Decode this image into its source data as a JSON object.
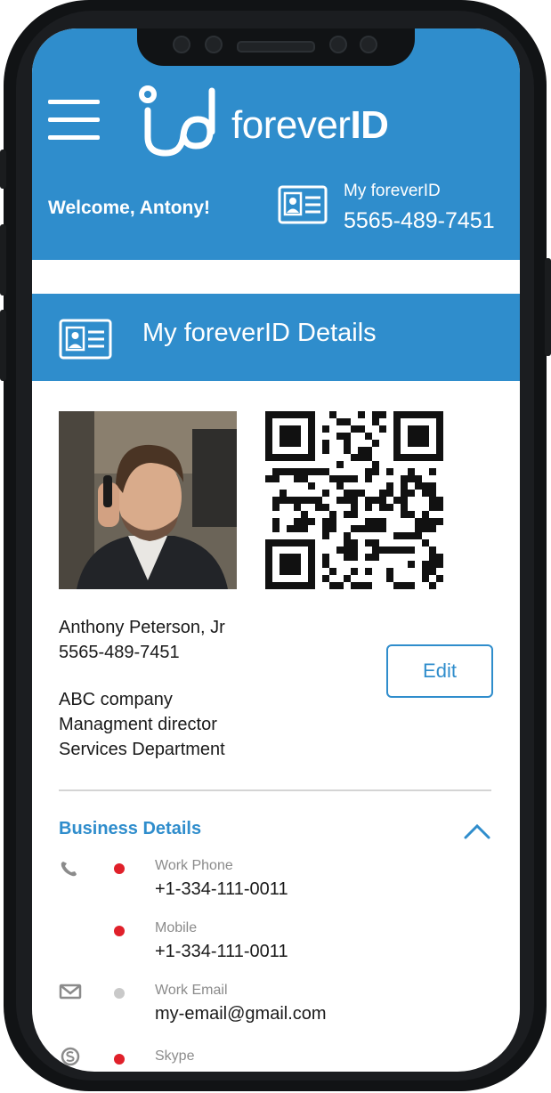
{
  "app": {
    "brand": "forever",
    "brand_bold": "ID",
    "welcome": "Welcome, Antony!",
    "my_id_label": "My foreverID",
    "my_id_number": "5565-489-7451"
  },
  "section": {
    "title": "My foreverID Details"
  },
  "profile": {
    "name": "Anthony Peterson, Jr",
    "id_number": "5565-489-7451",
    "company": "ABC company",
    "position": "Managment director",
    "department": "Services Department",
    "edit_label": "Edit"
  },
  "business": {
    "title": "Business Details",
    "rows": [
      {
        "label": "Work Phone",
        "value": "+1-334-111-0011",
        "icon": "phone-icon",
        "dot_color": "#e0202a"
      },
      {
        "label": "Mobile",
        "value": "+1-334-111-0011",
        "icon": "",
        "dot_color": "#e0202a"
      },
      {
        "label": "Work Email",
        "value": "my-email@gmail.com",
        "icon": "mail-icon",
        "dot_color": "#c9c9c9"
      },
      {
        "label": "Skype",
        "value": "",
        "icon": "skype-icon",
        "dot_color": "#e0202a"
      }
    ]
  },
  "colors": {
    "primary": "#2f8dcc",
    "accent_red": "#e0202a"
  }
}
